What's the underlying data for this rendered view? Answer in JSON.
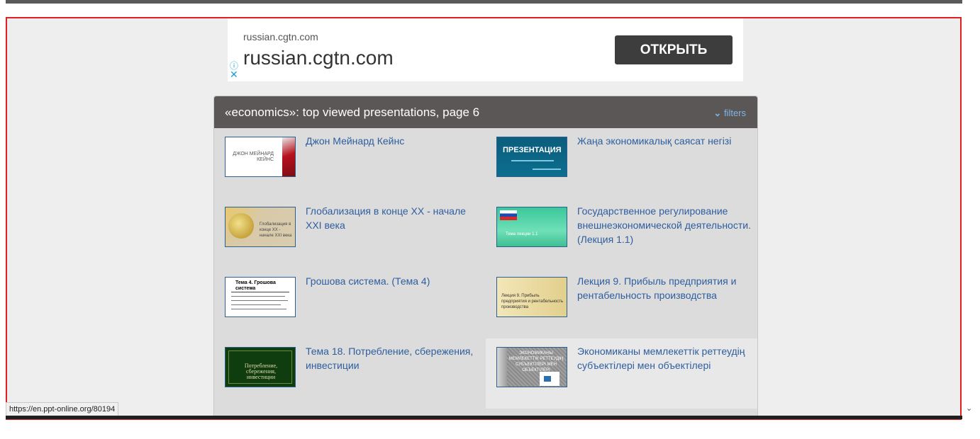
{
  "ad": {
    "domain_small": "russian.cgtn.com",
    "domain_big": "russian.cgtn.com",
    "open_label": "ОТКРЫТЬ",
    "info_icon": "info-icon",
    "close_icon": "close-icon"
  },
  "panel": {
    "title": "«economics»: top viewed presentations, page 6",
    "filters_label": "filters",
    "filters_icon": "chevron-down-icon"
  },
  "items": [
    {
      "title": "Джон Мейнард Кейнс",
      "thumb_text": "ДЖОН МЕЙНАРД КЕЙНС"
    },
    {
      "title": "Жаңа экономикалық саясат негізі",
      "thumb_text": "ПРЕЗЕНТАЦИЯ"
    },
    {
      "title": "Глобализация в конце XX - начале XXI века",
      "thumb_text": "Глобализация в конце XX - начале XXI века"
    },
    {
      "title": "Государственное регулирование внешнеэкономической деятельности. (Лекция 1.1)",
      "thumb_text": "Тема лекции 1.1"
    },
    {
      "title": "Грошова система. (Тема 4)",
      "thumb_text": "Тема 4. Грошова система"
    },
    {
      "title": "Лекция 9. Прибыль предприятия и рентабельность производства",
      "thumb_text": "Лекция 9. Прибыль предприятия и рентабельность производства"
    },
    {
      "title": "Тема 18. Потребление, сбережения, инвестиции",
      "thumb_text": "Потребление, сбережения, инвестиции"
    },
    {
      "title": "Экономиканы мемлекеттік реттеудің субъектілері мен объектілері",
      "thumb_text": "ЭКОНОМИКАНЫ МЕМЛЕКЕТТІК РЕТТЕУДІҢ СУБЪЕКТІЛЕРІ МЕН ОБЪЕКТІЛЕРІ"
    }
  ],
  "status_url": "https://en.ppt-online.org/80194"
}
